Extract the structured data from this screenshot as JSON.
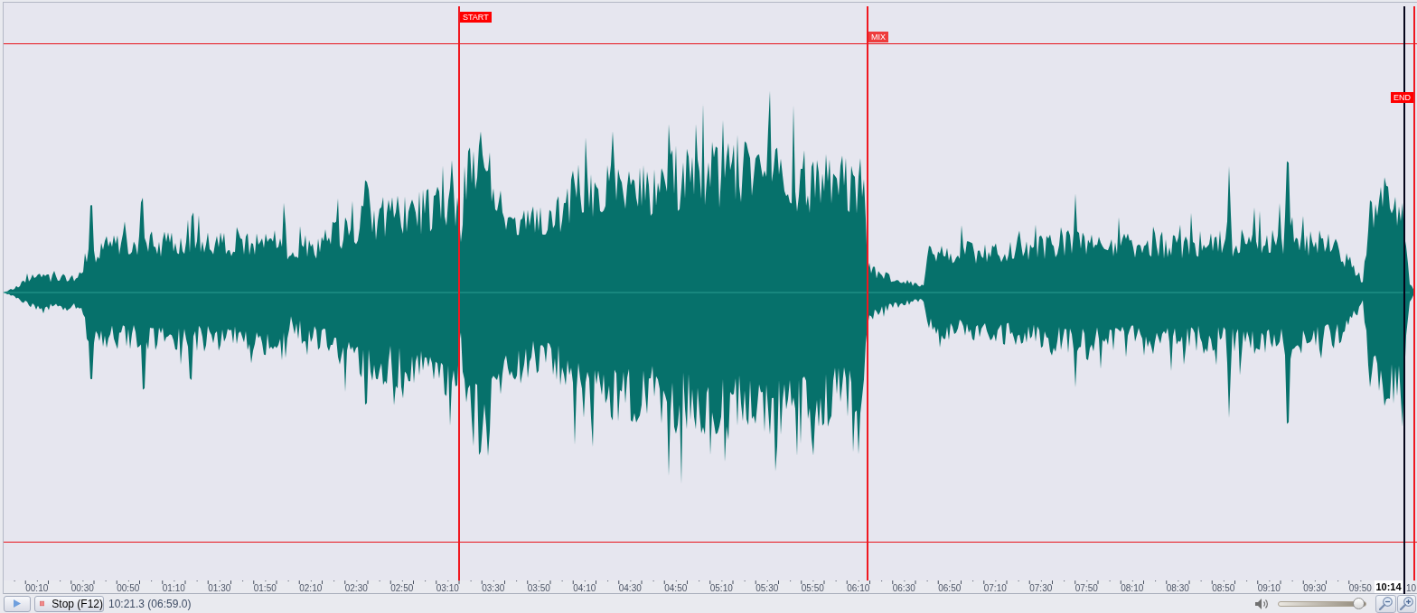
{
  "markers": [
    {
      "kind": "start",
      "label": "START"
    },
    {
      "kind": "mix",
      "label": "MIX"
    },
    {
      "kind": "end",
      "label": "END"
    }
  ],
  "ruler": {
    "labels": [
      "00:10",
      "00:30",
      "00:50",
      "01:10",
      "01:30",
      "01:50",
      "02:10",
      "02:30",
      "02:50",
      "03:10",
      "03:30",
      "03:50",
      "04:10",
      "04:30",
      "04:50",
      "05:10",
      "05:30",
      "05:50",
      "06:10",
      "06:30",
      "06:50",
      "07:10",
      "07:30",
      "07:50",
      "08:10",
      "08:30",
      "08:50",
      "09:10",
      "09:30",
      "09:50"
    ],
    "playhead_label": "10:14",
    "clipped_label": "10"
  },
  "toolbar": {
    "stop_button": "Stop (F12)",
    "position": "10:21.3 (06:59.0)",
    "volume": {
      "level": 0.98
    }
  }
}
